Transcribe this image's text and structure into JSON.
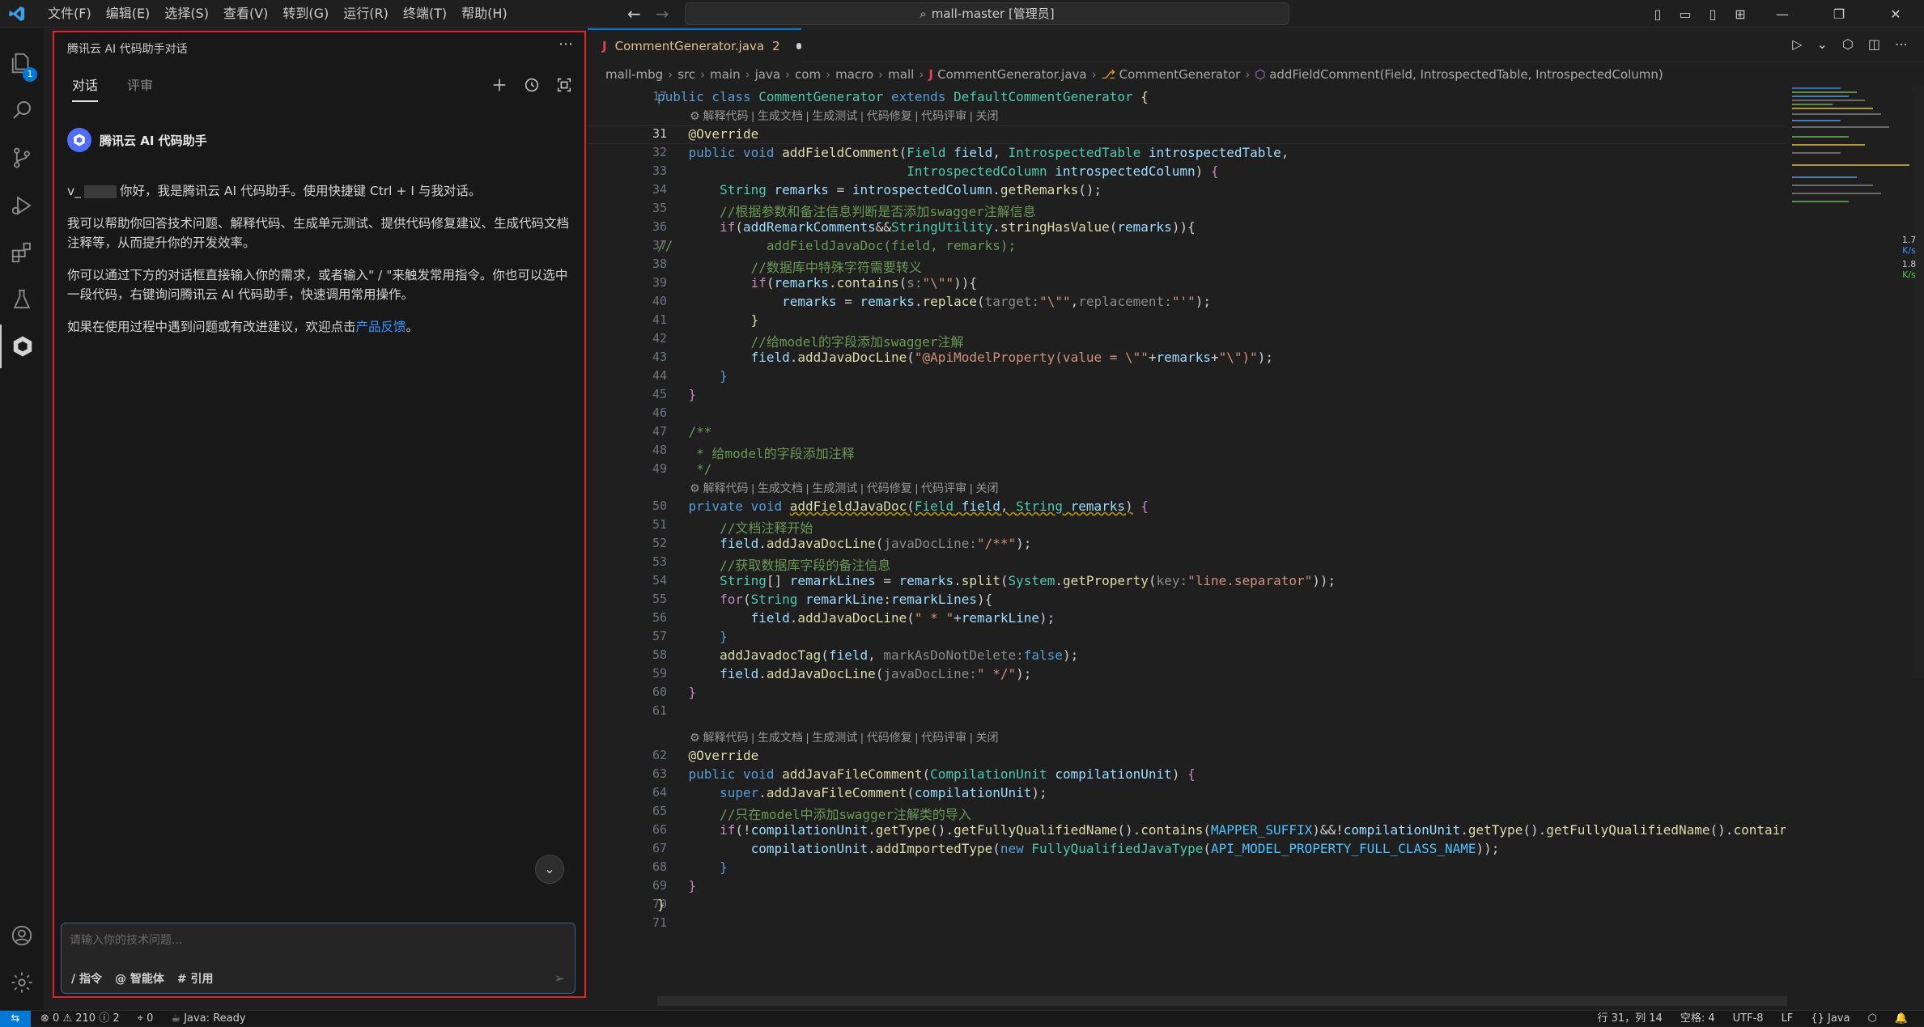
{
  "menu": [
    "文件(F)",
    "编辑(E)",
    "选择(S)",
    "查看(V)",
    "转到(G)",
    "运行(R)",
    "终端(T)",
    "帮助(H)"
  ],
  "command_center": "mall-master [管理员]",
  "activity": {
    "explorer_badge": "1"
  },
  "sidebar": {
    "title": "腾讯云 AI 代码助手对话",
    "tabs": [
      "对话",
      "评审"
    ],
    "assistant_name": "腾讯云 AI 代码助手",
    "greeting_prefix": "v_",
    "greeting": "你好，我是腾讯云 AI 代码助手。使用快捷键 Ctrl + I 与我对话。",
    "para2": "我可以帮助你回答技术问题、解释代码、生成单元测试、提供代码修复建议、生成代码文档注释等，从而提升你的开发效率。",
    "para3": "你可以通过下方的对话框直接输入你的需求，或者输入\" / \"来触发常用指令。你也可以选中一段代码，右键询问腾讯云 AI 代码助手，快速调用常用操作。",
    "para4_prefix": "如果在使用过程中遇到问题或有改进建议，欢迎点击",
    "para4_link": "产品反馈",
    "para4_suffix": "。",
    "input_placeholder": "请输入你的技术问题...",
    "tool_command": "/ 指令",
    "tool_agent": "@ 智能体",
    "tool_ref": "# 引用"
  },
  "editor": {
    "tab_file": "CommentGenerator.java",
    "tab_problems": "2",
    "breadcrumb": [
      "mall-mbg",
      "src",
      "main",
      "java",
      "com",
      "macro",
      "mall",
      "CommentGenerator.java",
      "CommentGenerator",
      "addFieldComment(Field, IntrospectedTable, IntrospectedColumn)"
    ],
    "codelens": "⚙ 解释代码 | 生成文档 | 生成测试 | 代码修复 | 代码评审 | 关闭",
    "line_numbers": [
      "17",
      "31",
      "32",
      "33",
      "34",
      "35",
      "36",
      "37",
      "38",
      "39",
      "40",
      "41",
      "42",
      "43",
      "44",
      "45",
      "46",
      "47",
      "48",
      "49",
      "50",
      "51",
      "52",
      "53",
      "54",
      "55",
      "56",
      "57",
      "58",
      "59",
      "60",
      "61",
      "62",
      "63",
      "64",
      "65",
      "66",
      "67",
      "68",
      "69",
      "70",
      "71"
    ]
  },
  "right_panel": {
    "up": "1.7",
    "up_unit": "K/s",
    "down": "1.8",
    "down_unit": "K/s"
  },
  "status": {
    "errors": "0",
    "warnings": "210",
    "infos": "2",
    "ports": "0",
    "java_status": "Java: Ready",
    "position": "行 31，列 14",
    "spaces": "空格: 4",
    "encoding": "UTF-8",
    "eol": "LF",
    "language": "Java"
  },
  "colors": {
    "accent": "#0078d4",
    "highlight_border": "#e0242a",
    "link": "#3794ff"
  }
}
